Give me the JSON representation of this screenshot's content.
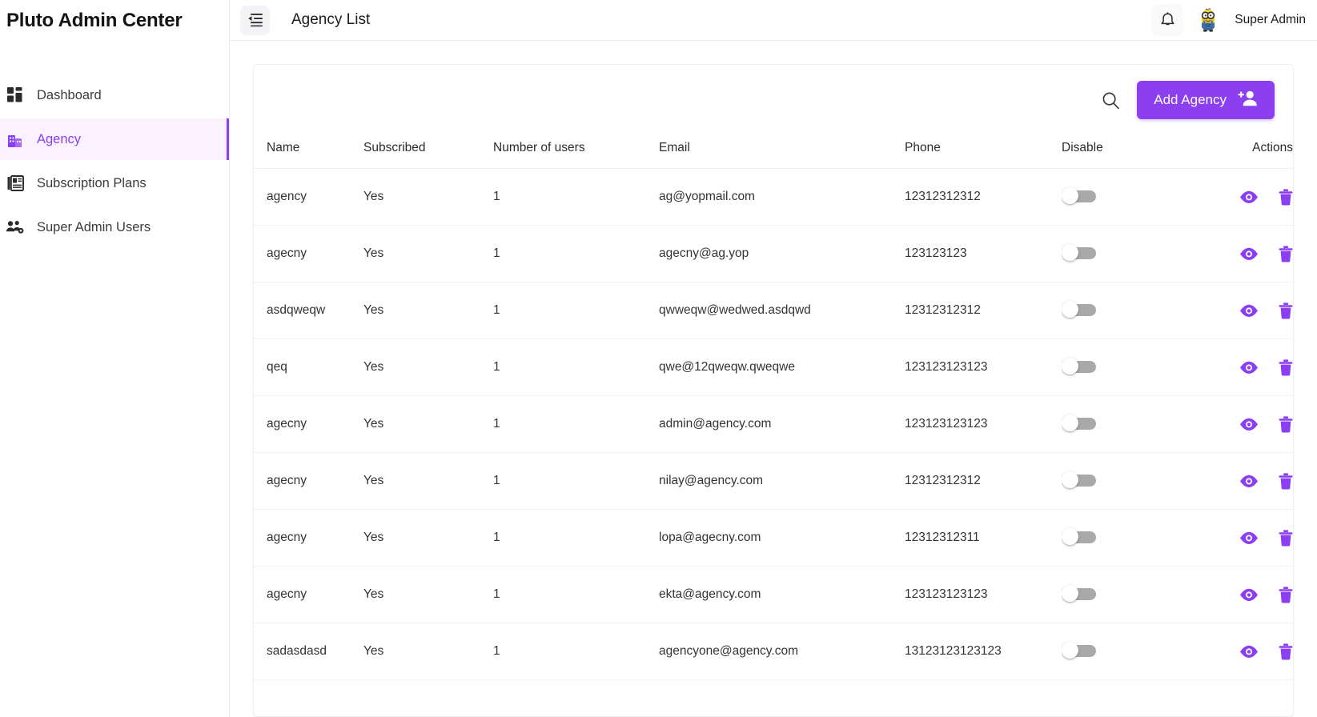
{
  "sidebar": {
    "brand": "Pluto Admin Center",
    "items": [
      {
        "label": "Dashboard",
        "icon": "dashboard-icon",
        "active": false
      },
      {
        "label": "Agency",
        "icon": "building-icon",
        "active": true
      },
      {
        "label": "Subscription Plans",
        "icon": "newspaper-icon",
        "active": false
      },
      {
        "label": "Super Admin Users",
        "icon": "users-gear-icon",
        "active": false
      }
    ]
  },
  "topbar": {
    "menu_icon": "menu-collapse-icon",
    "page_title": "Agency List",
    "bell_icon": "bell-icon",
    "avatar_icon": "minion-avatar",
    "user_name": "Super Admin"
  },
  "toolbar": {
    "search_icon": "search-icon",
    "add_label": "Add Agency",
    "add_icon": "person-add-icon"
  },
  "colors": {
    "accent": "#8b3ff0",
    "accent_soft_bg": "#faf3ff",
    "text": "#333333",
    "border": "#efeef2"
  },
  "table": {
    "columns": [
      "Name",
      "Subscribed",
      "Number of users",
      "Email",
      "Phone",
      "Disable",
      "Actions"
    ],
    "row_icons": {
      "view": "eye-icon",
      "delete": "trash-icon",
      "toggle": "disable-toggle"
    },
    "rows": [
      {
        "name": "agency",
        "subscribed": "Yes",
        "users": "1",
        "email": "ag@yopmail.com",
        "phone": "12312312312",
        "disabled": false
      },
      {
        "name": "agecny",
        "subscribed": "Yes",
        "users": "1",
        "email": "agecny@ag.yop",
        "phone": "123123123",
        "disabled": false
      },
      {
        "name": "asdqweqw",
        "subscribed": "Yes",
        "users": "1",
        "email": "qwweqw@wedwed.asdqwd",
        "phone": "12312312312",
        "disabled": false
      },
      {
        "name": "qeq",
        "subscribed": "Yes",
        "users": "1",
        "email": "qwe@12qweqw.qweqwe",
        "phone": "123123123123",
        "disabled": false
      },
      {
        "name": "agecny",
        "subscribed": "Yes",
        "users": "1",
        "email": "admin@agency.com",
        "phone": "123123123123",
        "disabled": false
      },
      {
        "name": "agecny",
        "subscribed": "Yes",
        "users": "1",
        "email": "nilay@agency.com",
        "phone": "12312312312",
        "disabled": false
      },
      {
        "name": "agecny",
        "subscribed": "Yes",
        "users": "1",
        "email": "lopa@agecny.com",
        "phone": "12312312311",
        "disabled": false
      },
      {
        "name": "agecny",
        "subscribed": "Yes",
        "users": "1",
        "email": "ekta@agency.com",
        "phone": "123123123123",
        "disabled": false
      },
      {
        "name": "sadasdasd",
        "subscribed": "Yes",
        "users": "1",
        "email": "agencyone@agency.com",
        "phone": "13123123123123",
        "disabled": false
      }
    ]
  }
}
